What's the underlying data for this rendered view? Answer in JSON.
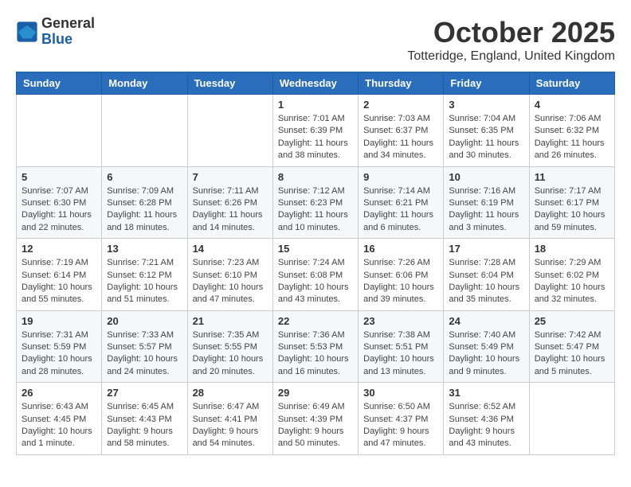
{
  "logo": {
    "general": "General",
    "blue": "Blue"
  },
  "title": {
    "month": "October 2025",
    "location": "Totteridge, England, United Kingdom"
  },
  "weekdays": [
    "Sunday",
    "Monday",
    "Tuesday",
    "Wednesday",
    "Thursday",
    "Friday",
    "Saturday"
  ],
  "weeks": [
    [
      {
        "day": "",
        "info": ""
      },
      {
        "day": "",
        "info": ""
      },
      {
        "day": "",
        "info": ""
      },
      {
        "day": "1",
        "info": "Sunrise: 7:01 AM\nSunset: 6:39 PM\nDaylight: 11 hours\nand 38 minutes."
      },
      {
        "day": "2",
        "info": "Sunrise: 7:03 AM\nSunset: 6:37 PM\nDaylight: 11 hours\nand 34 minutes."
      },
      {
        "day": "3",
        "info": "Sunrise: 7:04 AM\nSunset: 6:35 PM\nDaylight: 11 hours\nand 30 minutes."
      },
      {
        "day": "4",
        "info": "Sunrise: 7:06 AM\nSunset: 6:32 PM\nDaylight: 11 hours\nand 26 minutes."
      }
    ],
    [
      {
        "day": "5",
        "info": "Sunrise: 7:07 AM\nSunset: 6:30 PM\nDaylight: 11 hours\nand 22 minutes."
      },
      {
        "day": "6",
        "info": "Sunrise: 7:09 AM\nSunset: 6:28 PM\nDaylight: 11 hours\nand 18 minutes."
      },
      {
        "day": "7",
        "info": "Sunrise: 7:11 AM\nSunset: 6:26 PM\nDaylight: 11 hours\nand 14 minutes."
      },
      {
        "day": "8",
        "info": "Sunrise: 7:12 AM\nSunset: 6:23 PM\nDaylight: 11 hours\nand 10 minutes."
      },
      {
        "day": "9",
        "info": "Sunrise: 7:14 AM\nSunset: 6:21 PM\nDaylight: 11 hours\nand 6 minutes."
      },
      {
        "day": "10",
        "info": "Sunrise: 7:16 AM\nSunset: 6:19 PM\nDaylight: 11 hours\nand 3 minutes."
      },
      {
        "day": "11",
        "info": "Sunrise: 7:17 AM\nSunset: 6:17 PM\nDaylight: 10 hours\nand 59 minutes."
      }
    ],
    [
      {
        "day": "12",
        "info": "Sunrise: 7:19 AM\nSunset: 6:14 PM\nDaylight: 10 hours\nand 55 minutes."
      },
      {
        "day": "13",
        "info": "Sunrise: 7:21 AM\nSunset: 6:12 PM\nDaylight: 10 hours\nand 51 minutes."
      },
      {
        "day": "14",
        "info": "Sunrise: 7:23 AM\nSunset: 6:10 PM\nDaylight: 10 hours\nand 47 minutes."
      },
      {
        "day": "15",
        "info": "Sunrise: 7:24 AM\nSunset: 6:08 PM\nDaylight: 10 hours\nand 43 minutes."
      },
      {
        "day": "16",
        "info": "Sunrise: 7:26 AM\nSunset: 6:06 PM\nDaylight: 10 hours\nand 39 minutes."
      },
      {
        "day": "17",
        "info": "Sunrise: 7:28 AM\nSunset: 6:04 PM\nDaylight: 10 hours\nand 35 minutes."
      },
      {
        "day": "18",
        "info": "Sunrise: 7:29 AM\nSunset: 6:02 PM\nDaylight: 10 hours\nand 32 minutes."
      }
    ],
    [
      {
        "day": "19",
        "info": "Sunrise: 7:31 AM\nSunset: 5:59 PM\nDaylight: 10 hours\nand 28 minutes."
      },
      {
        "day": "20",
        "info": "Sunrise: 7:33 AM\nSunset: 5:57 PM\nDaylight: 10 hours\nand 24 minutes."
      },
      {
        "day": "21",
        "info": "Sunrise: 7:35 AM\nSunset: 5:55 PM\nDaylight: 10 hours\nand 20 minutes."
      },
      {
        "day": "22",
        "info": "Sunrise: 7:36 AM\nSunset: 5:53 PM\nDaylight: 10 hours\nand 16 minutes."
      },
      {
        "day": "23",
        "info": "Sunrise: 7:38 AM\nSunset: 5:51 PM\nDaylight: 10 hours\nand 13 minutes."
      },
      {
        "day": "24",
        "info": "Sunrise: 7:40 AM\nSunset: 5:49 PM\nDaylight: 10 hours\nand 9 minutes."
      },
      {
        "day": "25",
        "info": "Sunrise: 7:42 AM\nSunset: 5:47 PM\nDaylight: 10 hours\nand 5 minutes."
      }
    ],
    [
      {
        "day": "26",
        "info": "Sunrise: 6:43 AM\nSunset: 4:45 PM\nDaylight: 10 hours\nand 1 minute."
      },
      {
        "day": "27",
        "info": "Sunrise: 6:45 AM\nSunset: 4:43 PM\nDaylight: 9 hours\nand 58 minutes."
      },
      {
        "day": "28",
        "info": "Sunrise: 6:47 AM\nSunset: 4:41 PM\nDaylight: 9 hours\nand 54 minutes."
      },
      {
        "day": "29",
        "info": "Sunrise: 6:49 AM\nSunset: 4:39 PM\nDaylight: 9 hours\nand 50 minutes."
      },
      {
        "day": "30",
        "info": "Sunrise: 6:50 AM\nSunset: 4:37 PM\nDaylight: 9 hours\nand 47 minutes."
      },
      {
        "day": "31",
        "info": "Sunrise: 6:52 AM\nSunset: 4:36 PM\nDaylight: 9 hours\nand 43 minutes."
      },
      {
        "day": "",
        "info": ""
      }
    ]
  ]
}
